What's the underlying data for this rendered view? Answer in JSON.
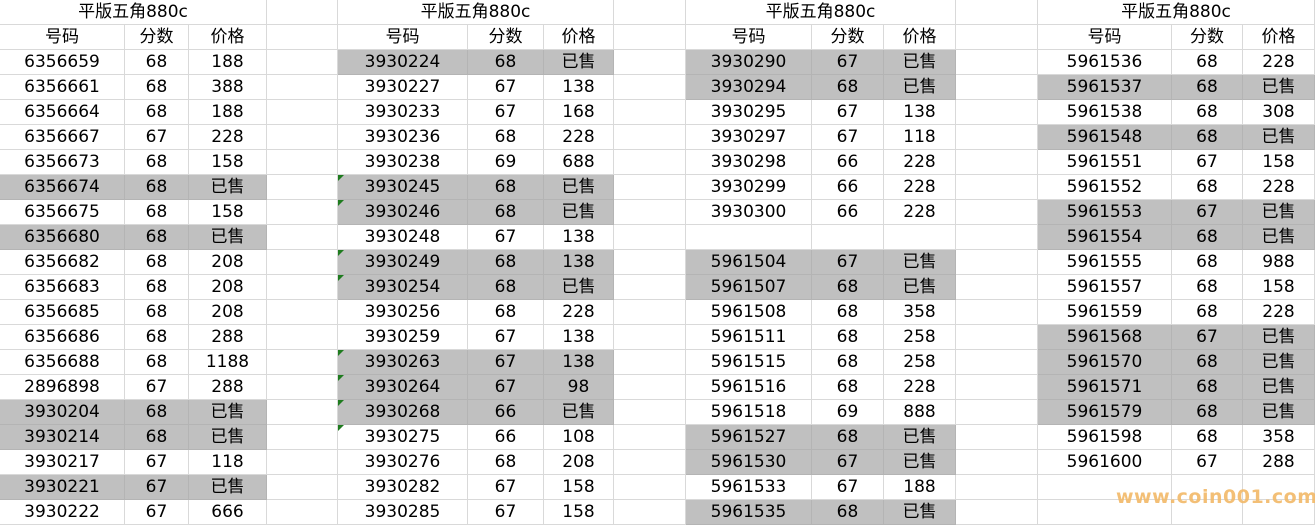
{
  "headers": {
    "number": "号码",
    "score": "分数",
    "price": "价格"
  },
  "sold_color": "#c0c0c0",
  "watermark": "www.coin001.com",
  "tables": [
    {
      "title": "平版五角880c",
      "rows": [
        {
          "number": "6356659",
          "score": "68",
          "price": "188",
          "sold": false
        },
        {
          "number": "6356661",
          "score": "68",
          "price": "388",
          "sold": false
        },
        {
          "number": "6356664",
          "score": "68",
          "price": "188",
          "sold": false
        },
        {
          "number": "6356667",
          "score": "67",
          "price": "228",
          "sold": false
        },
        {
          "number": "6356673",
          "score": "68",
          "price": "158",
          "sold": false
        },
        {
          "number": "6356674",
          "score": "68",
          "price": "已售",
          "sold": true
        },
        {
          "number": "6356675",
          "score": "68",
          "price": "158",
          "sold": false
        },
        {
          "number": "6356680",
          "score": "68",
          "price": "已售",
          "sold": true
        },
        {
          "number": "6356682",
          "score": "68",
          "price": "208",
          "sold": false
        },
        {
          "number": "6356683",
          "score": "68",
          "price": "208",
          "sold": false
        },
        {
          "number": "6356685",
          "score": "68",
          "price": "208",
          "sold": false
        },
        {
          "number": "6356686",
          "score": "68",
          "price": "288",
          "sold": false
        },
        {
          "number": "6356688",
          "score": "68",
          "price": "1188",
          "sold": false
        },
        {
          "number": "2896898",
          "score": "67",
          "price": "288",
          "sold": false
        },
        {
          "number": "3930204",
          "score": "68",
          "price": "已售",
          "sold": true
        },
        {
          "number": "3930214",
          "score": "68",
          "price": "已售",
          "sold": true
        },
        {
          "number": "3930217",
          "score": "67",
          "price": "118",
          "sold": false
        },
        {
          "number": "3930221",
          "score": "67",
          "price": "已售",
          "sold": true
        },
        {
          "number": "3930222",
          "score": "67",
          "price": "666",
          "sold": false
        }
      ]
    },
    {
      "title": "平版五角880c",
      "rows": [
        {
          "number": "3930224",
          "score": "68",
          "price": "已售",
          "sold": true
        },
        {
          "number": "3930227",
          "score": "67",
          "price": "138",
          "sold": false
        },
        {
          "number": "3930233",
          "score": "67",
          "price": "168",
          "sold": false
        },
        {
          "number": "3930236",
          "score": "68",
          "price": "228",
          "sold": false
        },
        {
          "number": "3930238",
          "score": "69",
          "price": "688",
          "sold": false
        },
        {
          "number": "3930245",
          "score": "68",
          "price": "已售",
          "sold": true,
          "mark": true
        },
        {
          "number": "3930246",
          "score": "68",
          "price": "已售",
          "sold": true,
          "mark": true
        },
        {
          "number": "3930248",
          "score": "67",
          "price": "138",
          "sold": false
        },
        {
          "number": "3930249",
          "score": "68",
          "price": "138",
          "sold": true,
          "mark": true
        },
        {
          "number": "3930254",
          "score": "68",
          "price": "已售",
          "sold": true,
          "mark": true
        },
        {
          "number": "3930256",
          "score": "68",
          "price": "228",
          "sold": false
        },
        {
          "number": "3930259",
          "score": "67",
          "price": "138",
          "sold": false
        },
        {
          "number": "3930263",
          "score": "67",
          "price": "138",
          "sold": true,
          "mark": true
        },
        {
          "number": "3930264",
          "score": "67",
          "price": "98",
          "sold": true,
          "mark": true
        },
        {
          "number": "3930268",
          "score": "66",
          "price": "已售",
          "sold": true,
          "mark": true
        },
        {
          "number": "3930275",
          "score": "66",
          "price": "108",
          "sold": false,
          "mark": true
        },
        {
          "number": "3930276",
          "score": "68",
          "price": "208",
          "sold": false
        },
        {
          "number": "3930282",
          "score": "67",
          "price": "158",
          "sold": false
        },
        {
          "number": "3930285",
          "score": "67",
          "price": "158",
          "sold": false
        }
      ]
    },
    {
      "title": "平版五角880c",
      "rows": [
        {
          "number": "3930290",
          "score": "67",
          "price": "已售",
          "sold": true
        },
        {
          "number": "3930294",
          "score": "68",
          "price": "已售",
          "sold": true
        },
        {
          "number": "3930295",
          "score": "67",
          "price": "138",
          "sold": false
        },
        {
          "number": "3930297",
          "score": "67",
          "price": "118",
          "sold": false
        },
        {
          "number": "3930298",
          "score": "66",
          "price": "228",
          "sold": false
        },
        {
          "number": "3930299",
          "score": "66",
          "price": "228",
          "sold": false
        },
        {
          "number": "3930300",
          "score": "66",
          "price": "228",
          "sold": false
        },
        {
          "number": "",
          "score": "",
          "price": "",
          "sold": false
        },
        {
          "number": "5961504",
          "score": "67",
          "price": "已售",
          "sold": true
        },
        {
          "number": "5961507",
          "score": "68",
          "price": "已售",
          "sold": true
        },
        {
          "number": "5961508",
          "score": "68",
          "price": "358",
          "sold": false
        },
        {
          "number": "5961511",
          "score": "68",
          "price": "258",
          "sold": false
        },
        {
          "number": "5961515",
          "score": "68",
          "price": "258",
          "sold": false
        },
        {
          "number": "5961516",
          "score": "68",
          "price": "228",
          "sold": false
        },
        {
          "number": "5961518",
          "score": "69",
          "price": "888",
          "sold": false
        },
        {
          "number": "5961527",
          "score": "68",
          "price": "已售",
          "sold": true
        },
        {
          "number": "5961530",
          "score": "67",
          "price": "已售",
          "sold": true
        },
        {
          "number": "5961533",
          "score": "67",
          "price": "188",
          "sold": false
        },
        {
          "number": "5961535",
          "score": "68",
          "price": "已售",
          "sold": true
        }
      ]
    },
    {
      "title": "平版五角880c",
      "rows": [
        {
          "number": "5961536",
          "score": "68",
          "price": "228",
          "sold": false
        },
        {
          "number": "5961537",
          "score": "68",
          "price": "已售",
          "sold": true
        },
        {
          "number": "5961538",
          "score": "68",
          "price": "308",
          "sold": false
        },
        {
          "number": "5961548",
          "score": "68",
          "price": "已售",
          "sold": true
        },
        {
          "number": "5961551",
          "score": "67",
          "price": "158",
          "sold": false
        },
        {
          "number": "5961552",
          "score": "68",
          "price": "228",
          "sold": false
        },
        {
          "number": "5961553",
          "score": "67",
          "price": "已售",
          "sold": true
        },
        {
          "number": "5961554",
          "score": "68",
          "price": "已售",
          "sold": true
        },
        {
          "number": "5961555",
          "score": "68",
          "price": "988",
          "sold": false
        },
        {
          "number": "5961557",
          "score": "68",
          "price": "158",
          "sold": false
        },
        {
          "number": "5961559",
          "score": "68",
          "price": "228",
          "sold": false
        },
        {
          "number": "5961568",
          "score": "67",
          "price": "已售",
          "sold": true
        },
        {
          "number": "5961570",
          "score": "68",
          "price": "已售",
          "sold": true
        },
        {
          "number": "5961571",
          "score": "68",
          "price": "已售",
          "sold": true
        },
        {
          "number": "5961579",
          "score": "68",
          "price": "已售",
          "sold": true
        },
        {
          "number": "5961598",
          "score": "68",
          "price": "358",
          "sold": false
        },
        {
          "number": "5961600",
          "score": "67",
          "price": "288",
          "sold": false
        }
      ]
    }
  ]
}
